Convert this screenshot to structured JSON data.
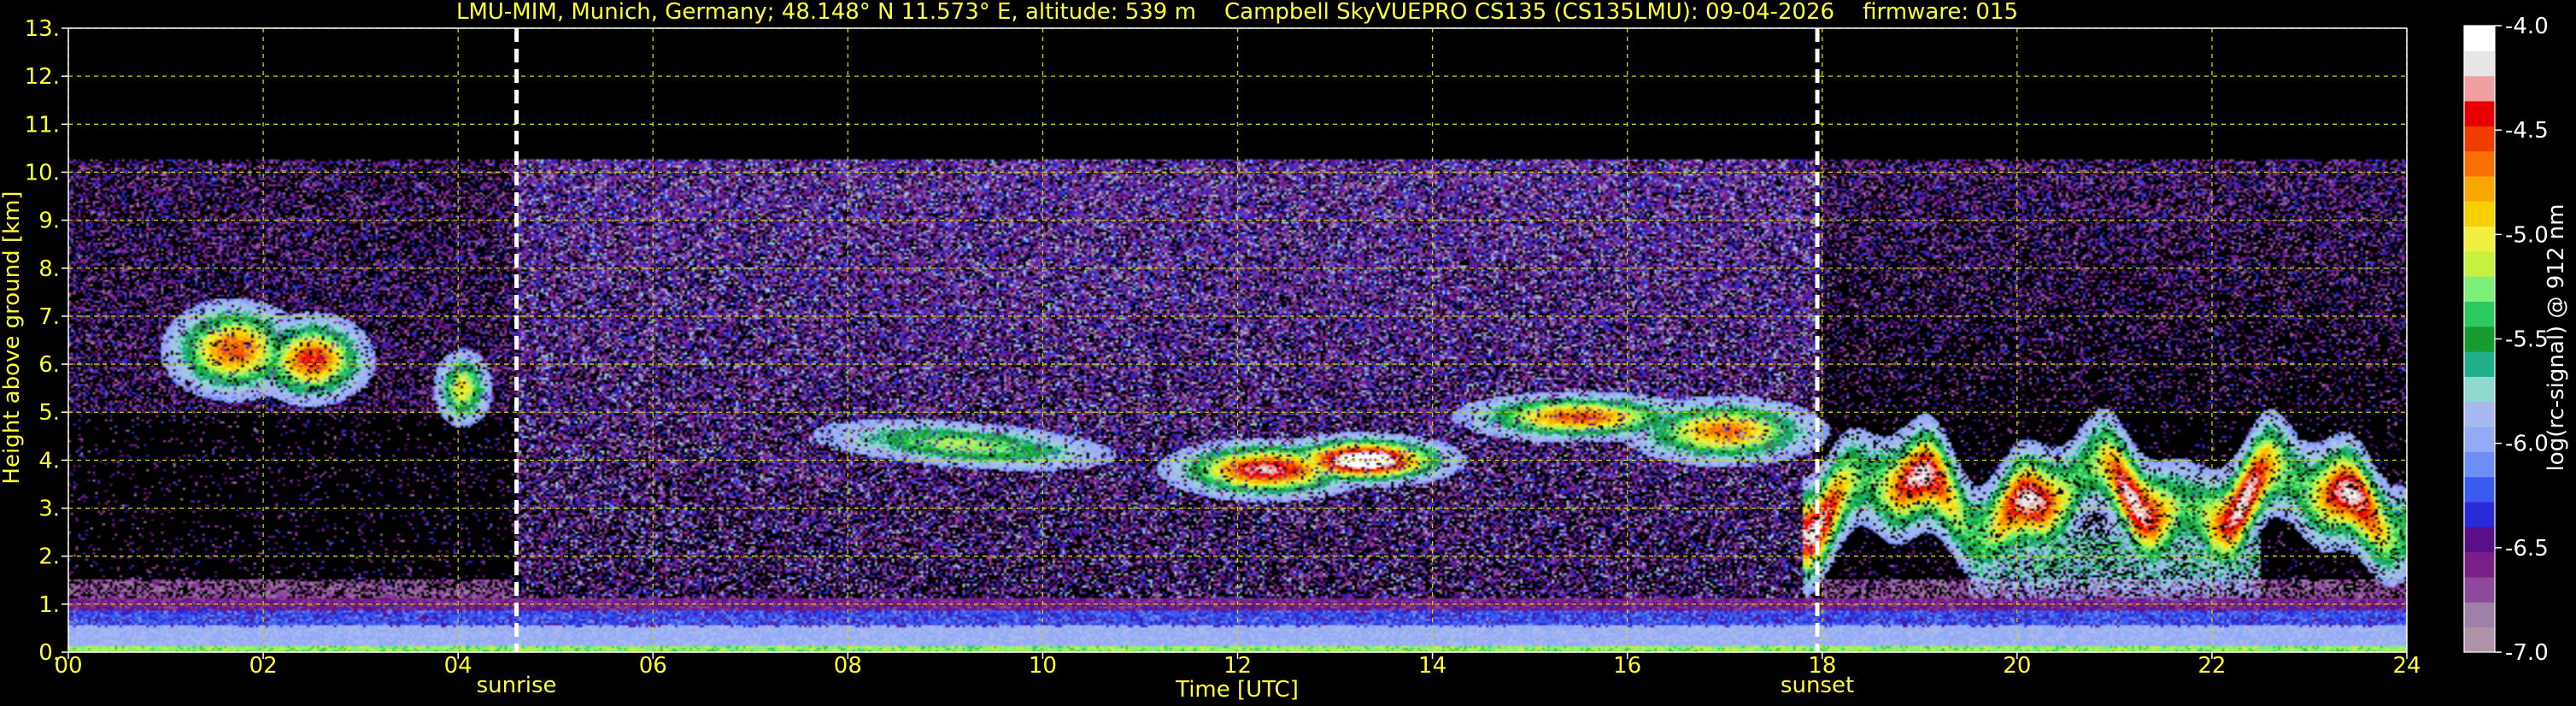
{
  "chart_data": {
    "type": "heatmap",
    "title": "LMU-MIM, Munich, Germany; 48.148° N 11.573° E, altitude: 539 m    Campbell SkyVUEPRO CS135 (CS135LMU): 09-04-2026    firmware: 015",
    "xlabel": "Time [UTC]",
    "ylabel": "Height above ground [km]",
    "xlim": [
      0,
      24
    ],
    "ylim": [
      0,
      13
    ],
    "x_ticks": [
      "00",
      "02",
      "04",
      "06",
      "08",
      "10",
      "12",
      "14",
      "16",
      "18",
      "20",
      "22",
      "24"
    ],
    "y_ticks": [
      "0.",
      "1.",
      "2.",
      "3.",
      "4.",
      "5.",
      "6.",
      "7.",
      "8.",
      "9.",
      "10.",
      "11.",
      "12.",
      "13."
    ],
    "grid": true,
    "colorbar": {
      "label": "log(rc-signal) @ 912 nm",
      "range": [
        -7.0,
        -4.0
      ],
      "ticks": [
        "-4.0",
        "-4.5",
        "-5.0",
        "-5.5",
        "-6.0",
        "-6.5",
        "-7.0"
      ]
    },
    "annotations": [
      {
        "label": "sunrise",
        "x": 4.6
      },
      {
        "label": "sunset",
        "x": 17.95
      }
    ],
    "features": [
      {
        "kind": "aerosol boundary layer",
        "x_range": [
          0,
          24
        ],
        "y_range": [
          0,
          1.1
        ]
      },
      {
        "kind": "noise region",
        "x_range": [
          0,
          24
        ],
        "y_range": [
          1.1,
          10.2
        ]
      },
      {
        "kind": "cirrus cloud",
        "x_range": [
          1.0,
          3.1
        ],
        "y_range": [
          5.3,
          8.0
        ]
      },
      {
        "kind": "cirrus cloud",
        "x_range": [
          3.7,
          4.3
        ],
        "y_range": [
          5.1,
          6.5
        ]
      },
      {
        "kind": "mid-level cloud",
        "x_range": [
          8.0,
          10.5
        ],
        "y_range": [
          4.0,
          5.5
        ]
      },
      {
        "kind": "mid-level cloud",
        "x_range": [
          11.3,
          14.4
        ],
        "y_range": [
          3.3,
          4.8
        ]
      },
      {
        "kind": "mid-level cloud",
        "x_range": [
          15.0,
          17.8
        ],
        "y_range": [
          3.8,
          5.3
        ]
      },
      {
        "kind": "cloud",
        "x_range": [
          17.8,
          24
        ],
        "y_range": [
          1.3,
          5.3
        ]
      }
    ]
  },
  "colors": {
    "text": "#ffff33",
    "grid": "#d4d400",
    "marker": "#ffffff",
    "background": "#000000",
    "colormap": [
      "#b093a8",
      "#a07fa8",
      "#8e4a9a",
      "#7a1f86",
      "#5a0f8a",
      "#2a2ad8",
      "#3b5af0",
      "#6d8ef5",
      "#93abf5",
      "#a9b9f0",
      "#8fd9d0",
      "#22b08a",
      "#179a30",
      "#2cc860",
      "#7ef07a",
      "#c8f040",
      "#f0f040",
      "#f8d000",
      "#f8a800",
      "#f87000",
      "#f03c00",
      "#e80000",
      "#f0a0a0",
      "#e6e6e6",
      "#ffffff"
    ]
  }
}
